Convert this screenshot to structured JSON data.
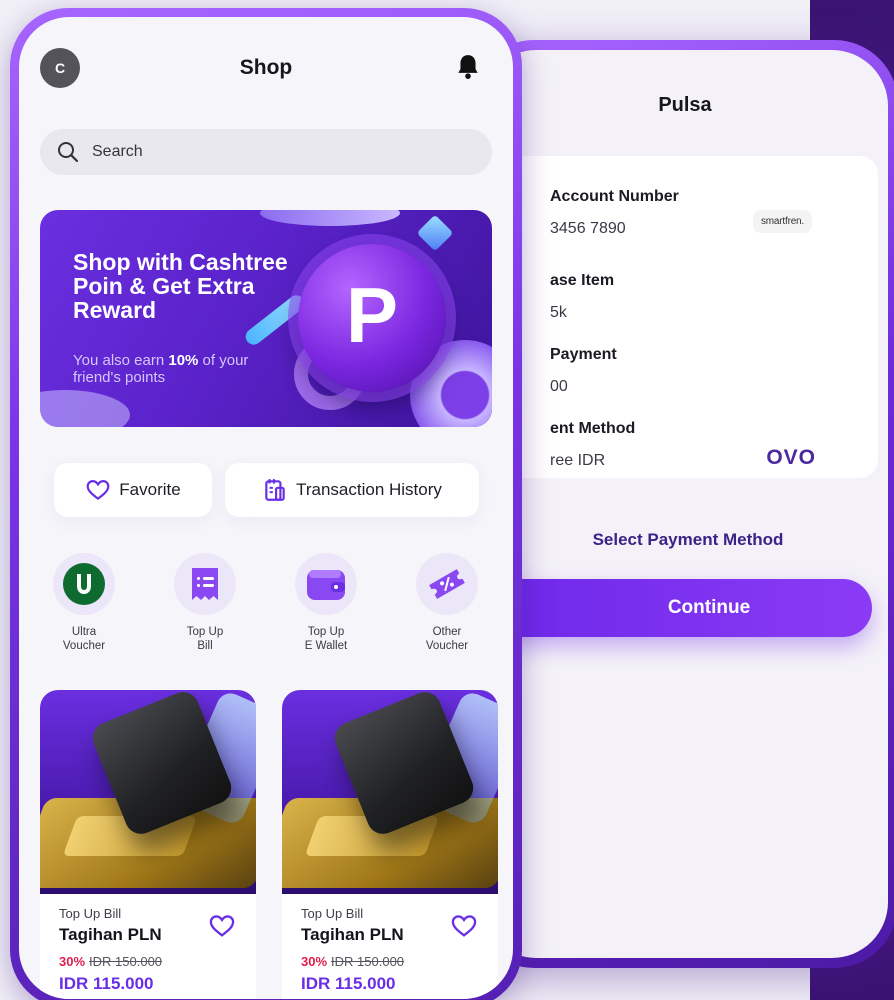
{
  "pulsa": {
    "title": "Pulsa",
    "account_label": "Account Number",
    "account_value": "3456 7890",
    "operator_logo": "smartfren.",
    "item_label": "ase Item",
    "item_value": "5k",
    "payment_label": "Payment",
    "payment_value": "00",
    "method_label": "ent Method",
    "method_value": "ree IDR",
    "method_logo": "OVO",
    "select_payment": "Select Payment Method",
    "continue": "Continue"
  },
  "shop": {
    "avatar_initial": "C",
    "title": "Shop",
    "search_placeholder": "Search",
    "banner": {
      "headline": "Shop with Cashtree Poin & Get Extra Reward",
      "sub_prefix": "You also earn ",
      "sub_bold": "10%",
      "sub_suffix": " of your friend's points",
      "coin_letter": "P"
    },
    "quick_actions": [
      {
        "label": "Favorite",
        "icon": "heart-icon"
      },
      {
        "label": "Transaction History",
        "icon": "receipt-icon"
      }
    ],
    "categories": [
      {
        "label": "Ultra\nVoucher",
        "icon": "ultra-voucher-icon"
      },
      {
        "label": "Top Up\nBill",
        "icon": "bill-icon"
      },
      {
        "label": "Top Up\nE Wallet",
        "icon": "wallet-icon"
      },
      {
        "label": "Other\nVoucher",
        "icon": "voucher-ticket-icon"
      }
    ],
    "products": [
      {
        "category": "Top Up Bill",
        "name": "Tagihan PLN",
        "discount": "30%",
        "old_price": "IDR 150.000",
        "price": "IDR 115.000"
      },
      {
        "category": "Top Up Bill",
        "name": "Tagihan PLN",
        "discount": "30%",
        "old_price": "IDR 150.000",
        "price": "IDR 115.000"
      }
    ]
  },
  "colors": {
    "accent": "#7a35e6",
    "price": "#6a2ee6",
    "discount": "#e01f4a",
    "ovo": "#4b2a9c"
  }
}
